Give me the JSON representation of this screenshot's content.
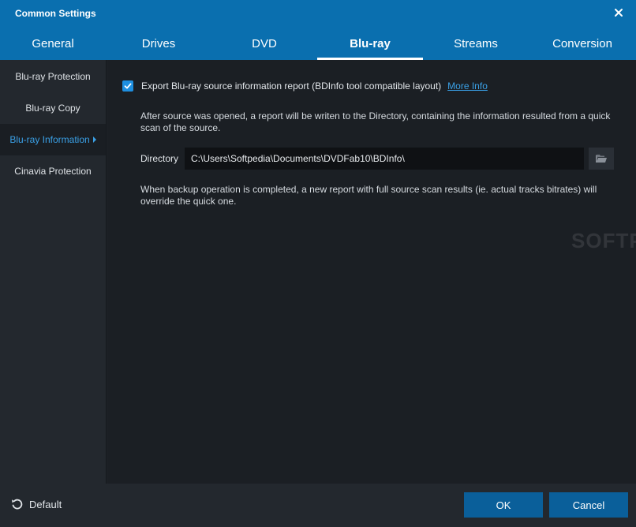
{
  "window": {
    "title": "Common Settings"
  },
  "tabs": [
    {
      "label": "General"
    },
    {
      "label": "Drives"
    },
    {
      "label": "DVD"
    },
    {
      "label": "Blu-ray",
      "active": true
    },
    {
      "label": "Streams"
    },
    {
      "label": "Conversion"
    }
  ],
  "sidebar": {
    "items": [
      {
        "label": "Blu-ray Protection"
      },
      {
        "label": "Blu-ray Copy"
      },
      {
        "label": "Blu-ray Information",
        "active": true
      },
      {
        "label": "Cinavia Protection"
      }
    ]
  },
  "content": {
    "export_checkbox": {
      "checked": true,
      "label": "Export Blu-ray source information report (BDInfo tool compatible layout)",
      "link": "More Info"
    },
    "description_open": "After source was opened, a report will be writen to the Directory, containing the information resulted from a quick scan of the source.",
    "directory_label": "Directory",
    "directory_value": "C:\\Users\\Softpedia\\Documents\\DVDFab10\\BDInfo\\",
    "description_backup": "When backup operation is completed, a new report with full source scan results (ie. actual tracks bitrates) will override the quick one.",
    "watermark": "SOFTPEDIA"
  },
  "footer": {
    "default_label": "Default",
    "ok_label": "OK",
    "cancel_label": "Cancel"
  },
  "colors": {
    "header": "#0a6faf",
    "accent": "#3aa0e6",
    "button": "#0a5f9a",
    "checkbox": "#1e8fe0"
  },
  "icons": {
    "close": "close-icon",
    "browse": "folder-icon",
    "default": "reset-icon",
    "check": "checkmark-icon",
    "caret": "caret-right-icon"
  }
}
